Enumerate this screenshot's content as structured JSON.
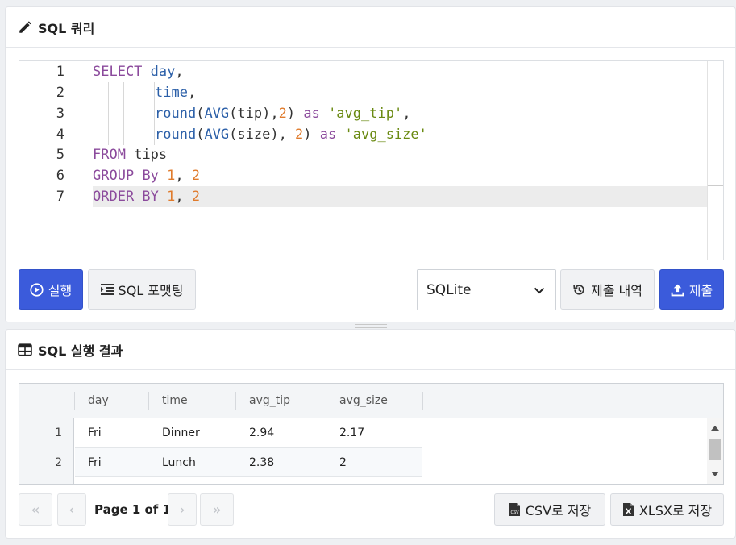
{
  "editor_panel": {
    "title": "SQL 쿼리",
    "line_numbers": [
      "1",
      "2",
      "3",
      "4",
      "5",
      "6",
      "7"
    ],
    "run_label": "실행",
    "format_label": "SQL 포맷팅",
    "dialect": "SQLite",
    "history_label": "제출 내역",
    "submit_label": "제출",
    "accent_color": "#3b5bdb"
  },
  "code": {
    "l1": {
      "kw": "SELECT",
      "id": "day",
      "p": ","
    },
    "l2": {
      "id": "time",
      "p": ","
    },
    "l3": {
      "fn": "round",
      "p1": "(",
      "agg": "AVG",
      "p2": "(tip),",
      "n": "2",
      "p3": ")",
      "as": "as",
      "s": "'avg_tip'",
      "p4": ","
    },
    "l4": {
      "fn": "round",
      "p1": "(",
      "agg": "AVG",
      "p2": "(size), ",
      "n": "2",
      "p3": ")",
      "as": "as",
      "s": "'avg_size'"
    },
    "l5": {
      "kw": "FROM",
      "t": "tips"
    },
    "l6": {
      "kw": "GROUP",
      "kw2": "By",
      "n1": "1",
      "c": ",",
      "n2": "2"
    },
    "l7": {
      "kw": "ORDER BY",
      "n1": "1",
      "c": ",",
      "n2": "2"
    }
  },
  "result_panel": {
    "title": "SQL 실행 결과",
    "columns": [
      "day",
      "time",
      "avg_tip",
      "avg_size"
    ],
    "rows": [
      {
        "num": "1",
        "day": "Fri",
        "time": "Dinner",
        "avg_tip": "2.94",
        "avg_size": "2.17"
      },
      {
        "num": "2",
        "day": "Fri",
        "time": "Lunch",
        "avg_tip": "2.38",
        "avg_size": "2"
      }
    ],
    "pager": {
      "first": "«",
      "prev": "‹",
      "text": "Page 1 of 1",
      "next": "›",
      "last": "»"
    },
    "csv_label": "CSV로 저장",
    "xlsx_label": "XLSX로 저장"
  }
}
